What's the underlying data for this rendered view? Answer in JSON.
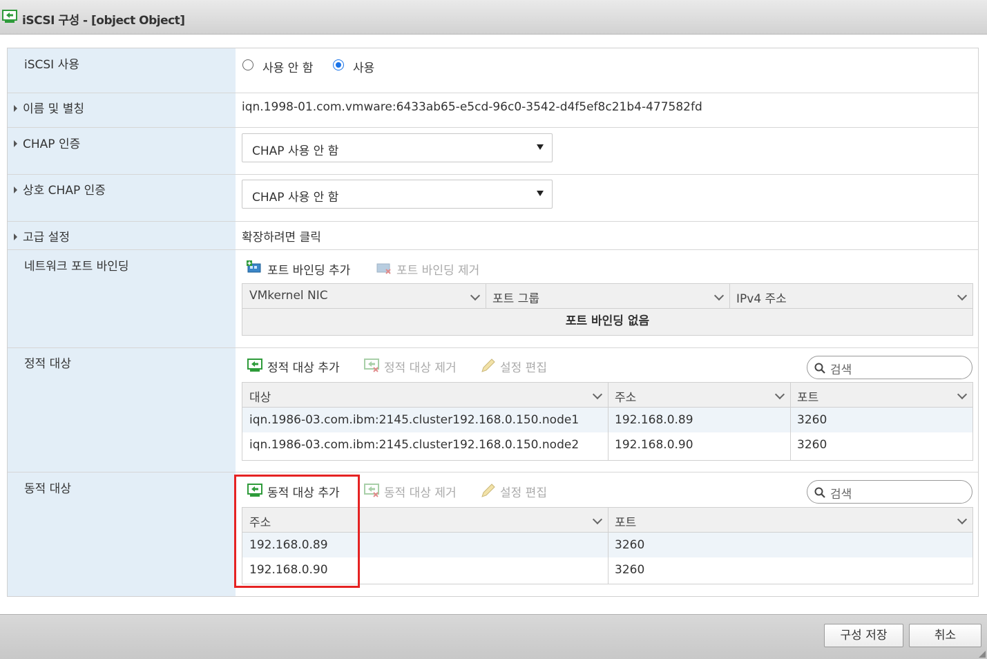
{
  "window": {
    "title": "iSCSI 구성 - [object Object]"
  },
  "rows": {
    "iscsi": {
      "label": "iSCSI 사용",
      "options": [
        {
          "label": "사용 안 함",
          "selected": false
        },
        {
          "label": "사용",
          "selected": true
        }
      ]
    },
    "name": {
      "label": "이름 및 별칭",
      "value": "iqn.1998-01.com.vmware:6433ab65-e5cd-96c0-3542-d4f5ef8c21b4-477582fd"
    },
    "chap": {
      "label": "CHAP 인증",
      "value": "CHAP 사용 안 함"
    },
    "mutual_chap": {
      "label": "상호 CHAP 인증",
      "value": "CHAP 사용 안 함"
    },
    "advanced": {
      "label": "고급 설정",
      "value": "확장하려면 클릭"
    },
    "port_binding": {
      "label": "네트워크 포트 바인딩",
      "add_label": "포트 바인딩 추가",
      "remove_label": "포트 바인딩 제거",
      "columns": [
        "VMkernel NIC",
        "포트 그룹",
        "IPv4 주소"
      ],
      "empty_text": "포트 바인딩 없음"
    },
    "static_targets": {
      "label": "정적 대상",
      "add_label": "정적 대상 추가",
      "remove_label": "정적 대상 제거",
      "edit_label": "설정 편집",
      "search_placeholder": "검색",
      "columns": [
        "대상",
        "주소",
        "포트"
      ],
      "rows": [
        [
          "iqn.1986-03.com.ibm:2145.cluster192.168.0.150.node1",
          "192.168.0.89",
          "3260"
        ],
        [
          "iqn.1986-03.com.ibm:2145.cluster192.168.0.150.node2",
          "192.168.0.90",
          "3260"
        ]
      ]
    },
    "dynamic_targets": {
      "label": "동적 대상",
      "add_label": "동적 대상 추가",
      "remove_label": "동적 대상 제거",
      "edit_label": "설정 편집",
      "search_placeholder": "검색",
      "columns": [
        "주소",
        "포트"
      ],
      "rows": [
        [
          "192.168.0.89",
          "3260"
        ],
        [
          "192.168.0.90",
          "3260"
        ]
      ]
    }
  },
  "footer": {
    "save_label": "구성 저장",
    "cancel_label": "취소"
  },
  "colors": {
    "accent": "#1a73e8",
    "highlight": "#e52222",
    "label_bg": "#e3eef7",
    "icon_green": "#2e9b3a"
  }
}
